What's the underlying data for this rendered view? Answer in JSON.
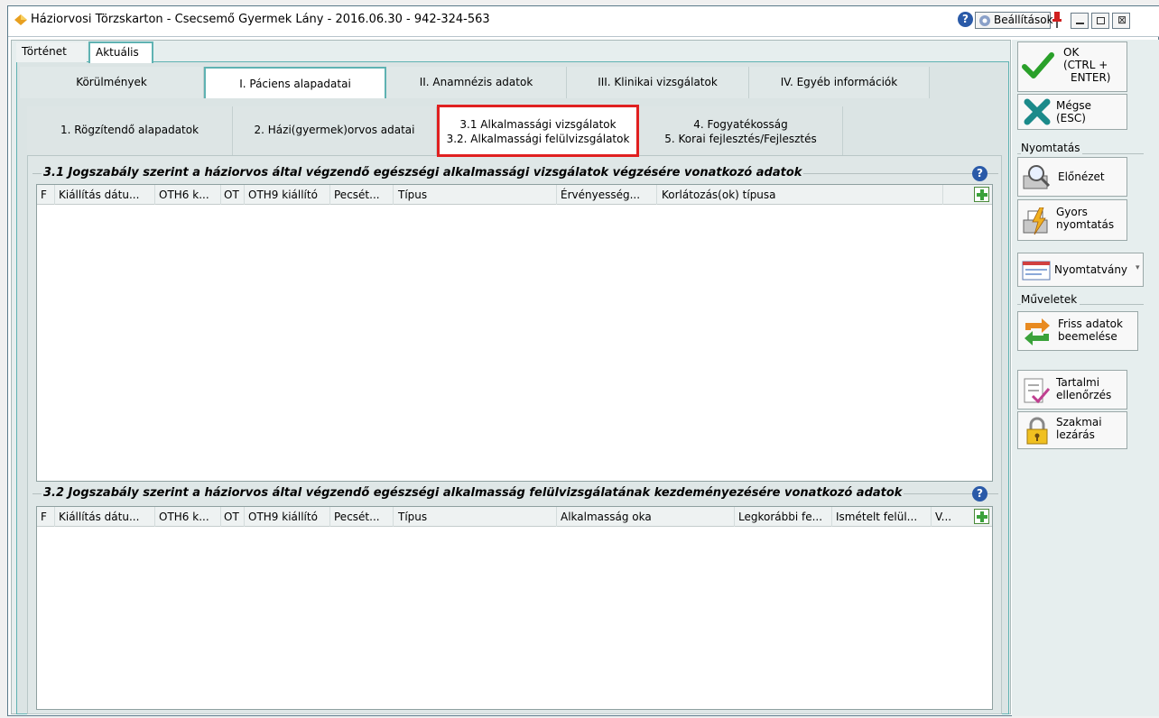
{
  "window": {
    "title": "Háziorvosi Törzskarton - Csecsemő Gyermek Lány - 2016.06.30 - 942-324-563",
    "settings_label": "Beállítások"
  },
  "top_tabs": [
    "Történet",
    "Aktuális"
  ],
  "main_tabs": [
    "Körülmények",
    "I. Páciens alapadatai",
    "II. Anamnézis adatok",
    "III. Klinikai vizsgálatok",
    "IV. Egyéb információk"
  ],
  "sub_tabs": [
    {
      "line1": "1. Rögzítendő alapadatok",
      "line2": ""
    },
    {
      "line1": "2. Házi(gyermek)orvos adatai",
      "line2": ""
    },
    {
      "line1": "3.1 Alkalmassági vizsgálatok",
      "line2": "3.2. Alkalmassági felülvizsgálatok"
    },
    {
      "line1": "4. Fogyatékosság",
      "line2": "5. Korai fejlesztés/Fejlesztés"
    }
  ],
  "section1": {
    "title": "3.1 Jogszabály szerint a háziorvos által végzendő egészségi alkalmassági vizsgálatok végzésére vonatkozó adatok",
    "columns": [
      "F",
      "Kiállítás dátu...",
      "OTH6 k...",
      "OT",
      "OTH9 kiállító",
      "Pecsét...",
      "Típus",
      "Érvényesség...",
      "Korlátozás(ok) típusa"
    ]
  },
  "section2": {
    "title": "3.2  Jogszabály szerint a háziorvos által végzendő egészségi alkalmasság felülvizsgálatának kezdeményezésére vonatkozó adatok",
    "columns": [
      "F",
      "Kiállítás dátu...",
      "OTH6 k...",
      "OT",
      "OTH9 kiállító",
      "Pecsét...",
      "Típus",
      "Alkalmasság oka",
      "Legkorábbi fe...",
      "Ismételt felül...",
      "V..."
    ]
  },
  "side": {
    "ok": {
      "l1": "OK",
      "l2": "(CTRL +",
      "l3": "ENTER)"
    },
    "cancel": {
      "l1": "Mégse",
      "l2": "(ESC)"
    },
    "print_group": "Nyomtatás",
    "preview": "Előnézet",
    "quick_print": {
      "l1": "Gyors",
      "l2": "nyomtatás"
    },
    "form": "Nyomtatvány",
    "ops_group": "Műveletek",
    "fresh": {
      "l1": "Friss adatok",
      "l2": "beemelése"
    },
    "content_check": {
      "l1": "Tartalmi",
      "l2": "ellenőrzés"
    },
    "prof_close": {
      "l1": "Szakmai",
      "l2": "lezárás"
    }
  },
  "colors": {
    "accent": "#5fb2b2",
    "highlight": "#e02020",
    "ok_green": "#2aa02a",
    "cancel_teal": "#1b8a8a"
  }
}
